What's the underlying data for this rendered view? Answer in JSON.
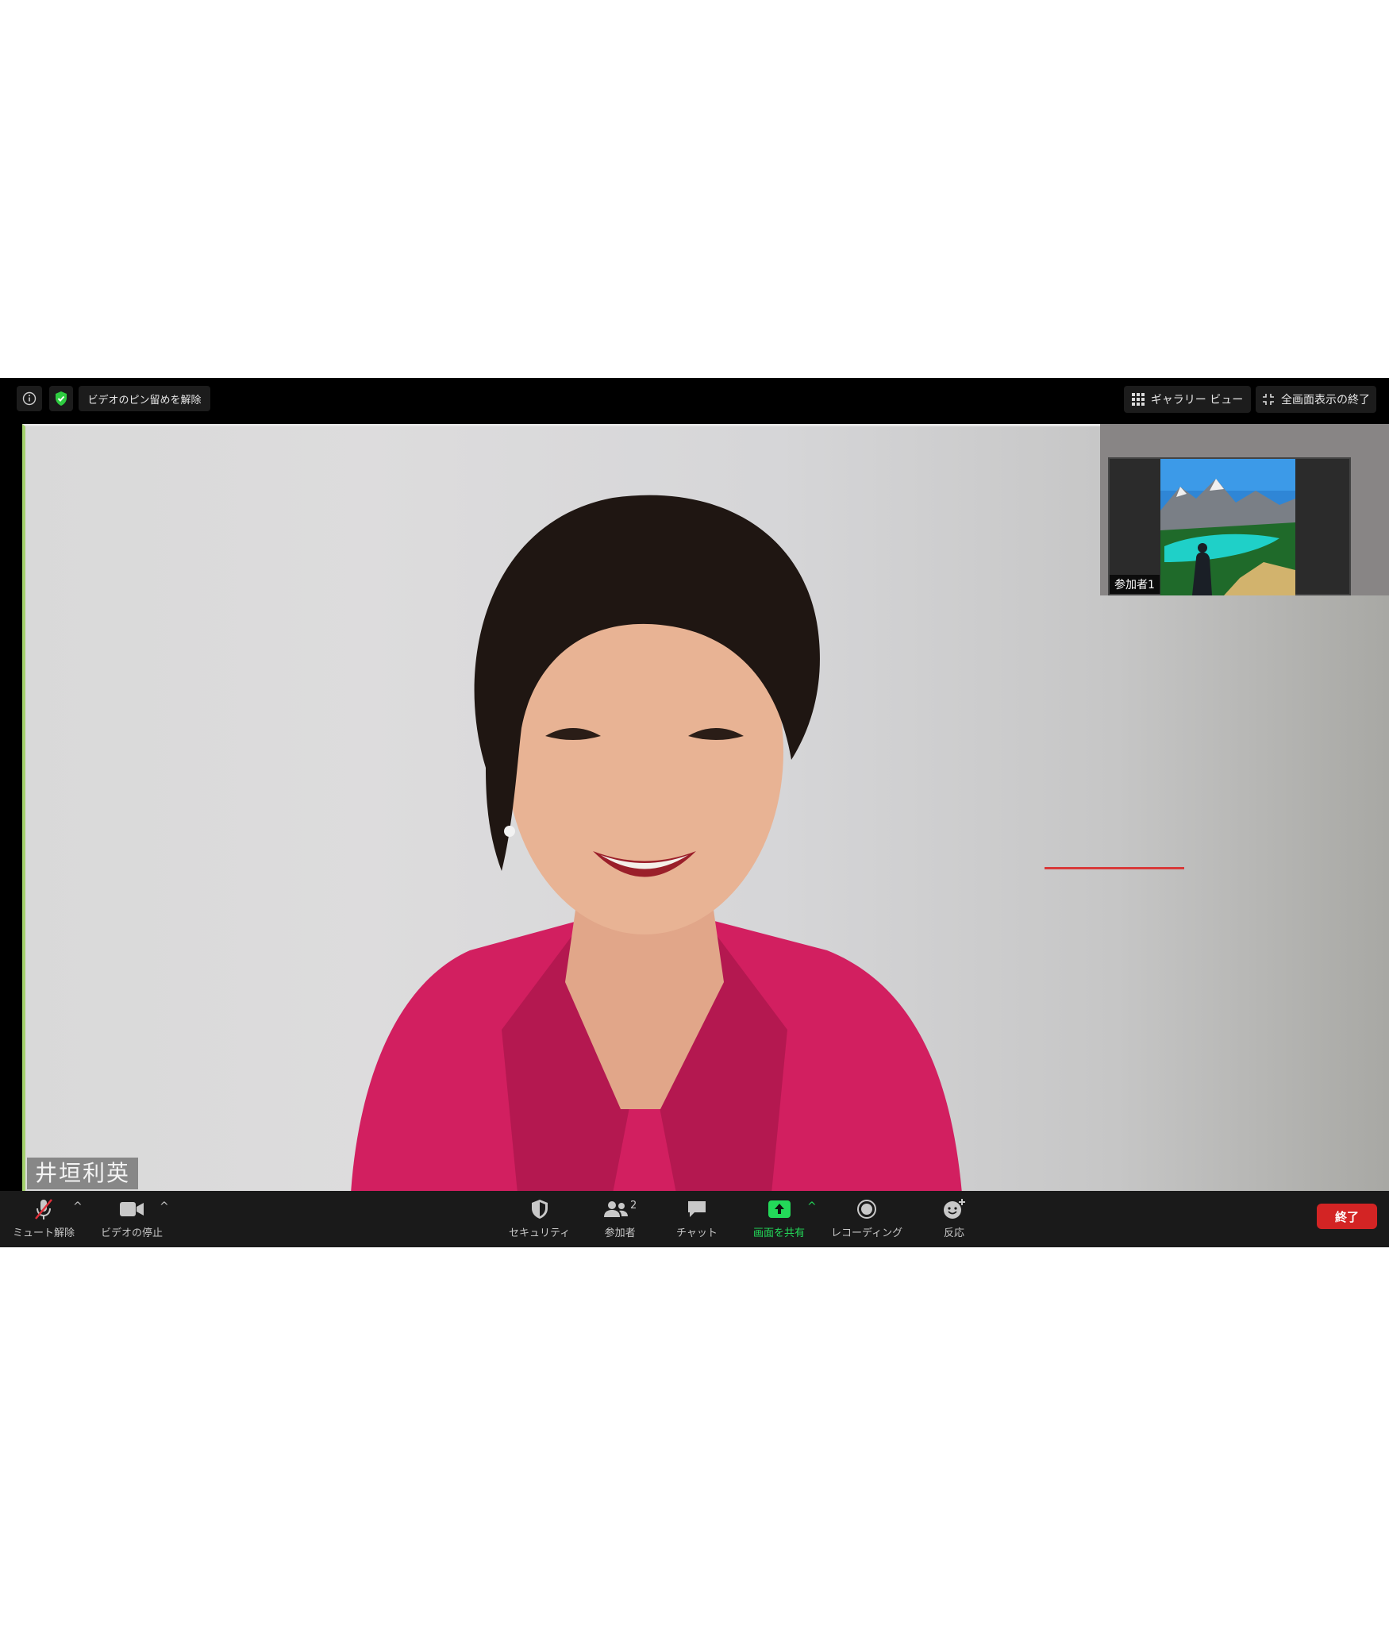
{
  "top_bar": {
    "unpin_label": "ビデオのピン留めを解除",
    "gallery_view_label": "ギャラリー ビュー",
    "exit_fullscreen_label": "全画面表示の終了"
  },
  "main_video": {
    "speaker_name": "井垣利英"
  },
  "thumbnail": {
    "participant_label": "参加者1"
  },
  "toolbar": {
    "unmute_label": "ミュート解除",
    "stop_video_label": "ビデオの停止",
    "security_label": "セキュリティ",
    "participants_label": "参加者",
    "participants_count": "2",
    "chat_label": "チャット",
    "share_screen_label": "画面を共有",
    "recording_label": "レコーディング",
    "reactions_label": "反応",
    "end_label": "終了"
  },
  "colors": {
    "share_green": "#23d959",
    "end_red": "#d32424",
    "shield_green": "#2ecc40",
    "active_speaker_border": "#a4d16d"
  }
}
